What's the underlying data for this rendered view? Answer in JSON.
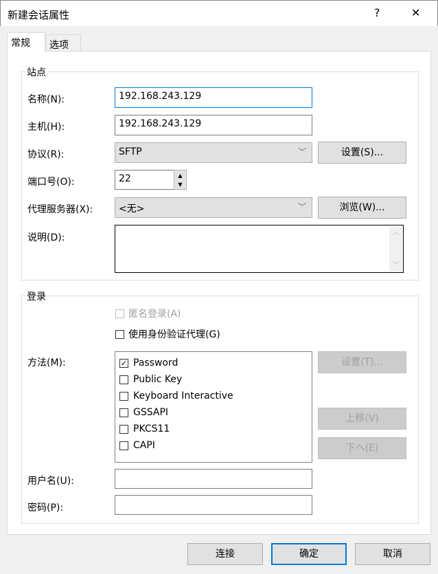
{
  "window": {
    "title": "新建会话属性",
    "help": "?",
    "close": "✕"
  },
  "tabs": [
    {
      "label": "常规"
    },
    {
      "label": "选项"
    }
  ],
  "site": {
    "group": "站点",
    "name_label": "名称(N):",
    "name_value": "192.168.243.129",
    "host_label": "主机(H):",
    "host_value": "192.168.243.129",
    "protocol_label": "协议(R):",
    "protocol_value": "SFTP",
    "protocol_settings": "设置(S)...",
    "port_label": "端口号(O):",
    "port_value": "22",
    "proxy_label": "代理服务器(X):",
    "proxy_value": "<无>",
    "proxy_browse": "浏览(W)...",
    "desc_label": "说明(D):",
    "desc_value": ""
  },
  "login": {
    "group": "登录",
    "anonymous": "匿名登录(A)",
    "agent": "使用身份验证代理(G)",
    "method_label": "方法(M):",
    "methods": [
      {
        "label": "Password",
        "checked": true
      },
      {
        "label": "Public Key",
        "checked": false
      },
      {
        "label": "Keyboard Interactive",
        "checked": false
      },
      {
        "label": "GSSAPI",
        "checked": false
      },
      {
        "label": "PKCS11",
        "checked": false
      },
      {
        "label": "CAPI",
        "checked": false
      }
    ],
    "settings": "设置(T)...",
    "up": "上移(V)",
    "down": "下へ(E)",
    "user_label": "用户名(U):",
    "user_value": "",
    "pass_label": "密码(P):",
    "pass_value": ""
  },
  "footer": {
    "connect": "连接",
    "ok": "确定",
    "cancel": "取消"
  },
  "colors": {
    "focus": "#0078d7"
  }
}
